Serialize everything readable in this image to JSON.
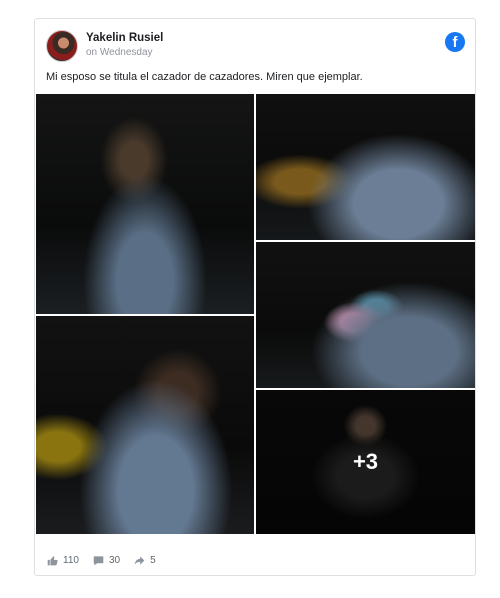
{
  "post": {
    "author": "Yakelin Rusiel",
    "date": "on Wednesday",
    "caption": "Mi esposo se titula el cazador de cazadores. Miren que ejemplar.",
    "brand_color": "#1877f2"
  },
  "photos": {
    "more_count": "+3"
  },
  "footer": {
    "likes": "110",
    "comments": "30",
    "shares": "5"
  }
}
